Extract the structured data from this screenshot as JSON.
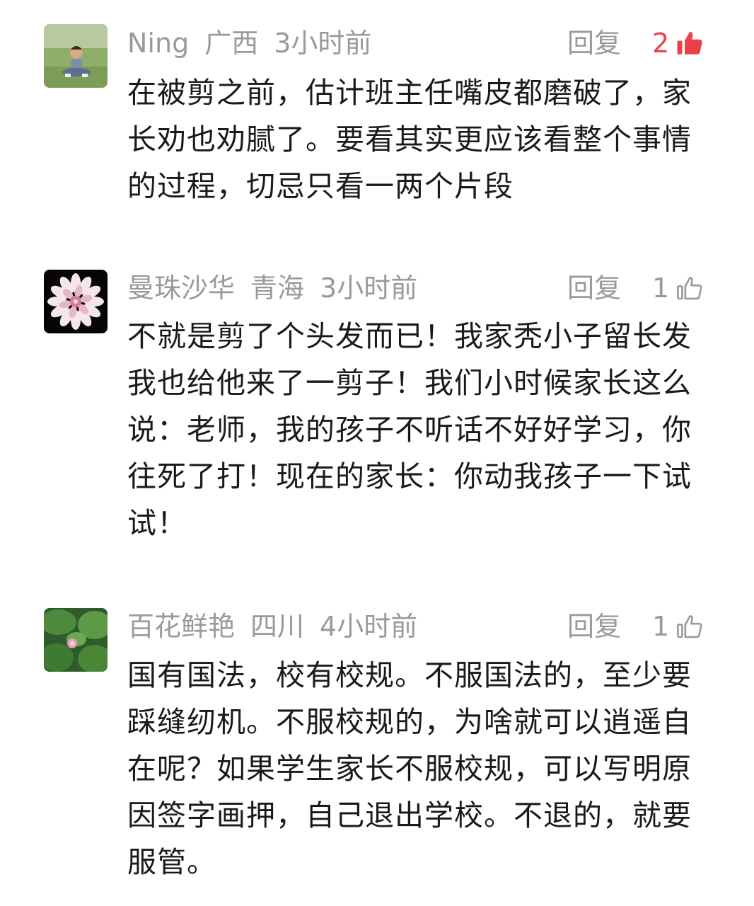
{
  "comments": [
    {
      "author": "Ning",
      "region": "广西",
      "time": "3小时前",
      "reply_label": "回复",
      "likes": "2",
      "liked": true,
      "avatar_icon": "child-photo-avatar",
      "text": "在被剪之前，估计班主任嘴皮都磨破了，家长劝也劝腻了。要看其实更应该看整个事情的过程，切忌只看一两个片段"
    },
    {
      "author": "曼珠沙华",
      "region": "青海",
      "time": "3小时前",
      "reply_label": "回复",
      "likes": "1",
      "liked": false,
      "avatar_icon": "flower-avatar",
      "text": "不就是剪了个头发而已！我家秃小子留长发我也给他来了一剪子！我们小时候家长这么说：老师，我的孩子不听话不好好学习，你往死了打！现在的家长：你动我孩子一下试试！"
    },
    {
      "author": "百花鲜艳",
      "region": "四川",
      "time": "4小时前",
      "reply_label": "回复",
      "likes": "1",
      "liked": false,
      "avatar_icon": "lotus-avatar",
      "text": "国有国法，校有校规。不服国法的，至少要踩缝纫机。不服校规的，为啥就可以逍遥自在呢？如果学生家长不服校规，可以写明原因签字画押，自己退出学校。不退的，就要服管。"
    }
  ],
  "colors": {
    "meta_gray": "#9a9a9a",
    "like_red": "#e94249",
    "text": "#1a1a1a"
  }
}
